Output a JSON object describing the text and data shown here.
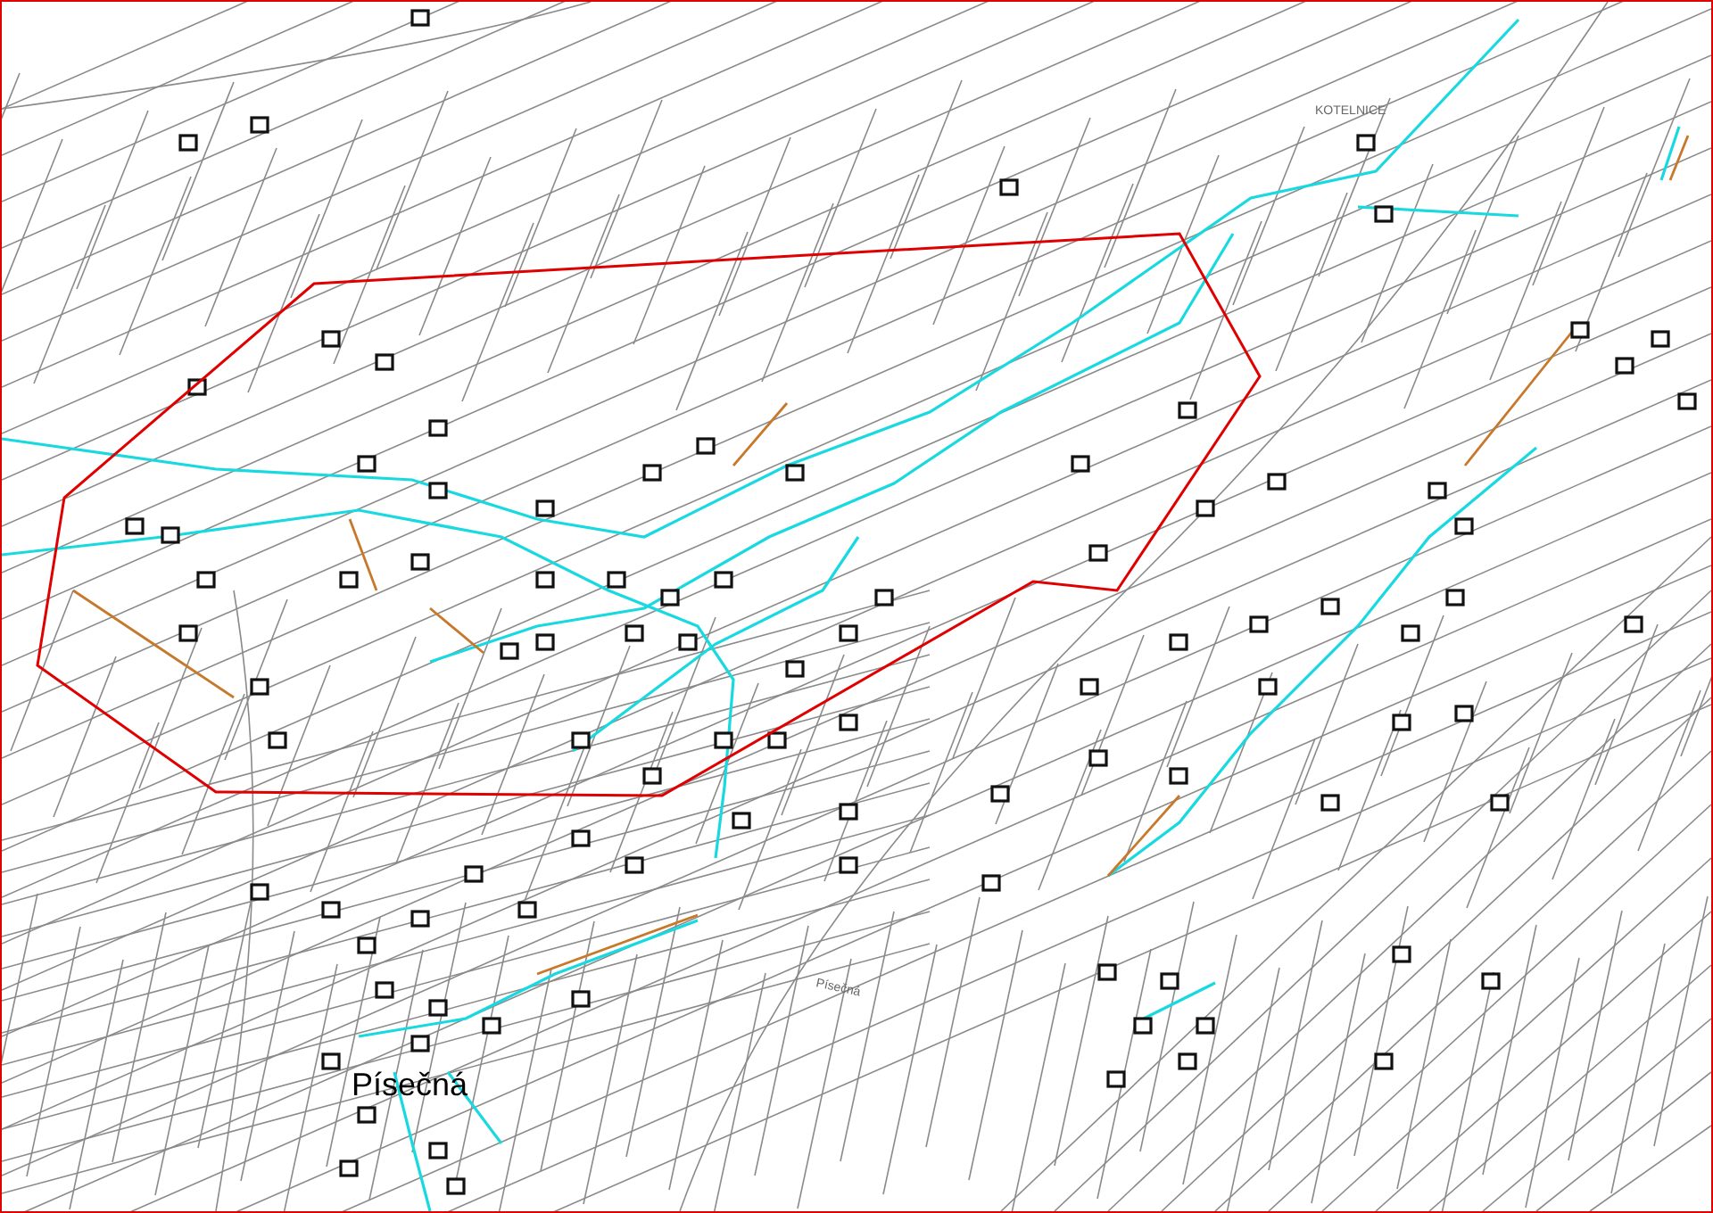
{
  "map": {
    "labels": [
      {
        "text": "KOTELNICE",
        "kind": "locality"
      },
      {
        "text": "Písečná",
        "kind": "street"
      },
      {
        "text": "Písečná",
        "kind": "town"
      }
    ]
  }
}
